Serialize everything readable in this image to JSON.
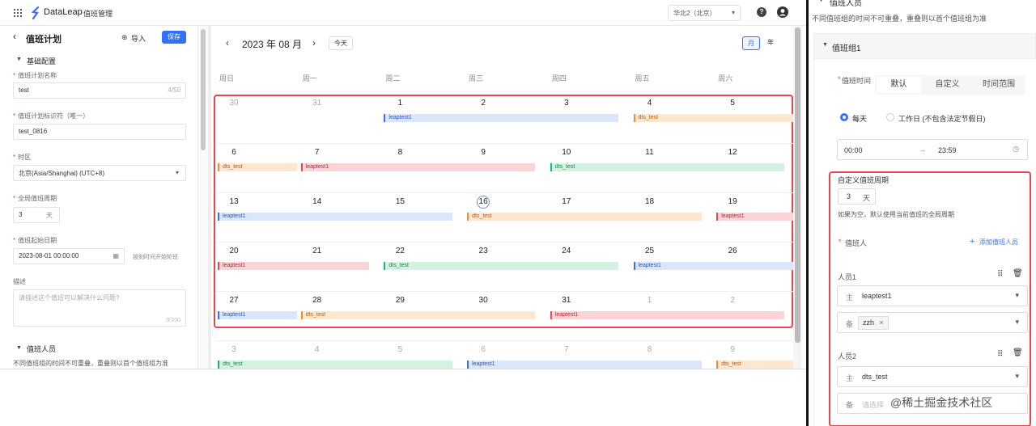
{
  "topbar": {
    "app_name": "DataLeap",
    "module": "值班管理",
    "region": "华北2（北京）"
  },
  "plan": {
    "title": "值班计划",
    "import_label": "导入",
    "save_label": "保存",
    "basic_section": "基础配置",
    "name_label": "值班计划名称",
    "name_value": "test",
    "name_count": "4/50",
    "id_label": "值班计划标识符（唯一）",
    "id_value": "test_0816",
    "tz_label": "时区",
    "tz_value": "北京(Asia/Shanghai) (UTC+8)",
    "cycle_label": "全局值班周期",
    "cycle_value": "3",
    "cycle_unit": "天",
    "start_label": "值班起始日期",
    "start_value": "2023-08-01 00:00:00",
    "start_hint": "按刻时间开始轮班",
    "desc_label": "描述",
    "desc_placeholder": "请描述这个值班可以解决什么问题?",
    "desc_count": "0/200",
    "staff_section": "值班人员",
    "staff_desc": "不同值班组的时间不可重叠，重叠则以首个值班组为准"
  },
  "calendar": {
    "month_title": "2023 年 08 月",
    "today_label": "今天",
    "view_month": "月",
    "view_year": "年",
    "weekdays": [
      "周日",
      "周一",
      "周二",
      "周三",
      "周四",
      "周五",
      "周六"
    ],
    "weeks": [
      [
        "30",
        "31",
        "1",
        "2",
        "3",
        "4",
        "5"
      ],
      [
        "6",
        "7",
        "8",
        "9",
        "10",
        "11",
        "12"
      ],
      [
        "13",
        "14",
        "15",
        "16",
        "17",
        "18",
        "19"
      ],
      [
        "20",
        "21",
        "22",
        "23",
        "24",
        "25",
        "26"
      ],
      [
        "27",
        "28",
        "29",
        "30",
        "31",
        "1",
        "2"
      ],
      [
        "3",
        "4",
        "5",
        "6",
        "7",
        "8",
        "9"
      ]
    ],
    "events": [
      {
        "week": 0,
        "start": 2,
        "span": 2.82,
        "label": "leaptest1",
        "color": "blue"
      },
      {
        "week": 0,
        "start": 5,
        "span": 1.95,
        "label": "dts_test",
        "color": "orange"
      },
      {
        "week": 1,
        "start": 0,
        "span": 0.95,
        "label": "dts_test",
        "color": "orange"
      },
      {
        "week": 1,
        "start": 1,
        "span": 2.82,
        "label": "leaptest1",
        "color": "red"
      },
      {
        "week": 1,
        "start": 4,
        "span": 2.82,
        "label": "dts_test",
        "color": "green"
      },
      {
        "week": 2,
        "start": 0,
        "span": 2.82,
        "label": "leaptest1",
        "color": "blue"
      },
      {
        "week": 2,
        "start": 3,
        "span": 2.82,
        "label": "dts_test",
        "color": "orange"
      },
      {
        "week": 2,
        "start": 6,
        "span": 0.95,
        "label": "leaptest1",
        "color": "red"
      },
      {
        "week": 3,
        "start": 0,
        "span": 1.82,
        "label": "leaptest1",
        "color": "red"
      },
      {
        "week": 3,
        "start": 2,
        "span": 2.82,
        "label": "dts_test",
        "color": "green"
      },
      {
        "week": 3,
        "start": 5,
        "span": 1.95,
        "label": "leaptest1",
        "color": "blue"
      },
      {
        "week": 4,
        "start": 0,
        "span": 0.95,
        "label": "leaptest1",
        "color": "blue"
      },
      {
        "week": 4,
        "start": 1,
        "span": 2.82,
        "label": "dts_test",
        "color": "orange"
      },
      {
        "week": 4,
        "start": 4,
        "span": 2.82,
        "label": "leaptest1",
        "color": "red"
      },
      {
        "week": 5,
        "start": 0,
        "span": 2.82,
        "label": "dts_test",
        "color": "green"
      },
      {
        "week": 5,
        "start": 3,
        "span": 2.82,
        "label": "leaptest1",
        "color": "blue"
      },
      {
        "week": 5,
        "start": 6,
        "span": 0.95,
        "label": "dts_test",
        "color": "orange"
      }
    ]
  },
  "right": {
    "section_title": "值班人员",
    "section_desc": "不同值班组的时间不可重叠，重叠则以首个值班组为准",
    "group_title": "值班组1",
    "duty_time_label": "值班时间",
    "tabs": [
      "默认",
      "自定义",
      "时间范围"
    ],
    "radio_every_day": "每天",
    "radio_workday": "工作日 (不包含法定节假日)",
    "time_start": "00:00",
    "time_end": "23:59",
    "custom_cycle_label": "自定义值班周期",
    "custom_cycle_value": "3",
    "custom_cycle_unit": "天",
    "custom_cycle_hint": "如果为空，默认使用当前值班的全局周期",
    "duty_person_label": "值班人",
    "add_person_label": "添加值班人员",
    "person1_label": "人员1",
    "person1_primary_tag": "主",
    "person1_primary": "leaptest1",
    "person1_backup_tag": "备",
    "person1_backup_chip": "zzh",
    "person2_label": "人员2",
    "person2_primary_tag": "主",
    "person2_primary": "dts_test",
    "person2_backup_tag": "备",
    "person2_backup_placeholder": "请选择",
    "watermark": "@稀土掘金技术社区"
  }
}
